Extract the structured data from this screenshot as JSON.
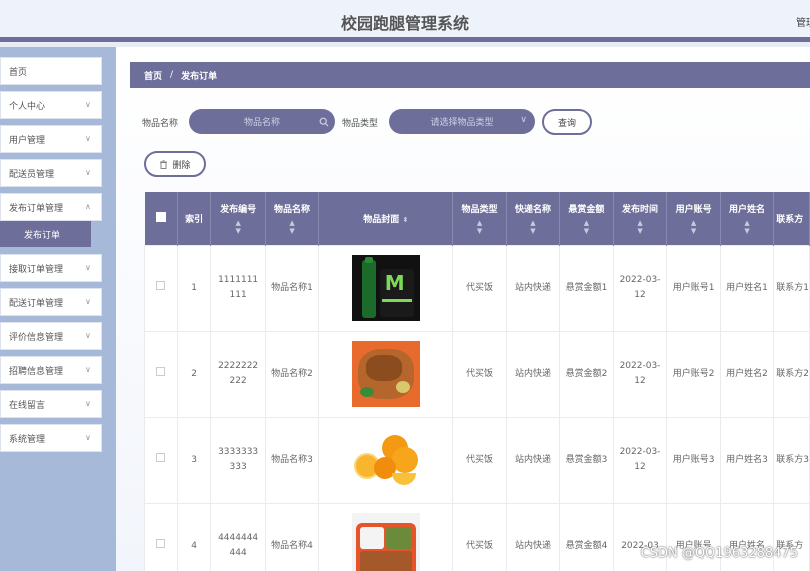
{
  "header": {
    "title": "校园跑腿管理系统",
    "admin_text": "管理"
  },
  "sidebar": {
    "items": [
      {
        "label": "首页",
        "chevron": false
      },
      {
        "label": "个人中心",
        "chevron": true
      },
      {
        "label": "用户管理",
        "chevron": true
      },
      {
        "label": "配送员管理",
        "chevron": true
      },
      {
        "label": "发布订单管理",
        "chevron": true
      },
      {
        "label": "接取订单管理",
        "chevron": true
      },
      {
        "label": "配送订单管理",
        "chevron": true
      },
      {
        "label": "评价信息管理",
        "chevron": true
      },
      {
        "label": "招聘信息管理",
        "chevron": true
      },
      {
        "label": "在线留言",
        "chevron": true
      },
      {
        "label": "系统管理",
        "chevron": true
      }
    ],
    "active_sub": "发布订单"
  },
  "breadcrumb": {
    "home": "首页",
    "sep": "/",
    "current": "发布订单"
  },
  "search": {
    "name_label": "物品名称",
    "name_placeholder": "物品名称",
    "type_label": "物品类型",
    "type_placeholder": "请选择物品类型",
    "query_button": "查询"
  },
  "toolbar": {
    "delete_button": "删除"
  },
  "table": {
    "headers": [
      "索引",
      "发布编号",
      "物品名称",
      "物品封面",
      "物品类型",
      "快递名称",
      "悬赏金额",
      "发布时间",
      "用户账号",
      "用户姓名",
      "联系方"
    ],
    "rows": [
      {
        "index": "1",
        "number": "1111111111",
        "name": "物品名称1",
        "image": "monster-can",
        "type": "代买饭",
        "express": "站内快递",
        "reward": "悬赏金额1",
        "time": "2022-03-12",
        "account": "用户账号1",
        "username": "用户姓名1",
        "contact": "联系方1"
      },
      {
        "index": "2",
        "number": "2222222222",
        "name": "物品名称2",
        "image": "fried-chicken",
        "type": "代买饭",
        "express": "站内快递",
        "reward": "悬赏金额2",
        "time": "2022-03-12",
        "account": "用户账号2",
        "username": "用户姓名2",
        "contact": "联系方2"
      },
      {
        "index": "3",
        "number": "3333333333",
        "name": "物品名称3",
        "image": "oranges",
        "type": "代买饭",
        "express": "站内快递",
        "reward": "悬赏金额3",
        "time": "2022-03-12",
        "account": "用户账号3",
        "username": "用户姓名3",
        "contact": "联系方3"
      },
      {
        "index": "4",
        "number": "4444444444",
        "name": "物品名称4",
        "image": "bento-box",
        "type": "代买饭",
        "express": "站内快递",
        "reward": "悬赏金额4",
        "time": "2022-03",
        "account": "用户账号",
        "username": "用户姓名",
        "contact": "联系方"
      }
    ]
  },
  "watermark": "CSDN @QQ1963288475"
}
